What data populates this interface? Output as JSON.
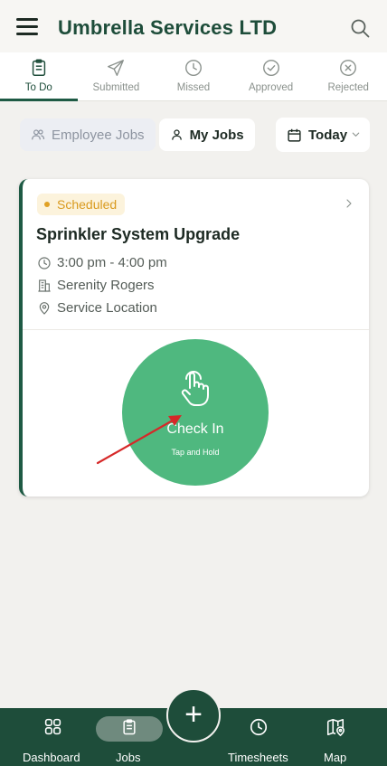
{
  "header": {
    "title": "Umbrella Services LTD"
  },
  "tabs": [
    {
      "label": "To Do",
      "icon": "clipboard-icon",
      "active": true
    },
    {
      "label": "Submitted",
      "icon": "paper-plane-icon",
      "active": false
    },
    {
      "label": "Missed",
      "icon": "clock-icon",
      "active": false
    },
    {
      "label": "Approved",
      "icon": "check-circle-icon",
      "active": false
    },
    {
      "label": "Rejected",
      "icon": "x-circle-icon",
      "active": false
    }
  ],
  "filters": {
    "employee_jobs": "Employee Jobs",
    "my_jobs": "My Jobs",
    "date": "Today"
  },
  "job": {
    "status": "Scheduled",
    "title": "Sprinkler System Upgrade",
    "time": "3:00 pm - 4:00 pm",
    "client": "Serenity Rogers",
    "location": "Service Location",
    "checkin_label": "Check In",
    "checkin_hint": "Tap and Hold"
  },
  "bottom_nav": [
    {
      "label": "Dashboard",
      "icon": "grid-icon"
    },
    {
      "label": "Jobs",
      "icon": "clipboard-icon",
      "active": true
    },
    {
      "label": "Timesheets",
      "icon": "clock-icon"
    },
    {
      "label": "Map",
      "icon": "map-pin-icon"
    }
  ],
  "colors": {
    "brand": "#1e4d3a",
    "accent_green": "#4fb87f",
    "status_scheduled": "#e0a124",
    "annotation_arrow": "#d62828"
  }
}
